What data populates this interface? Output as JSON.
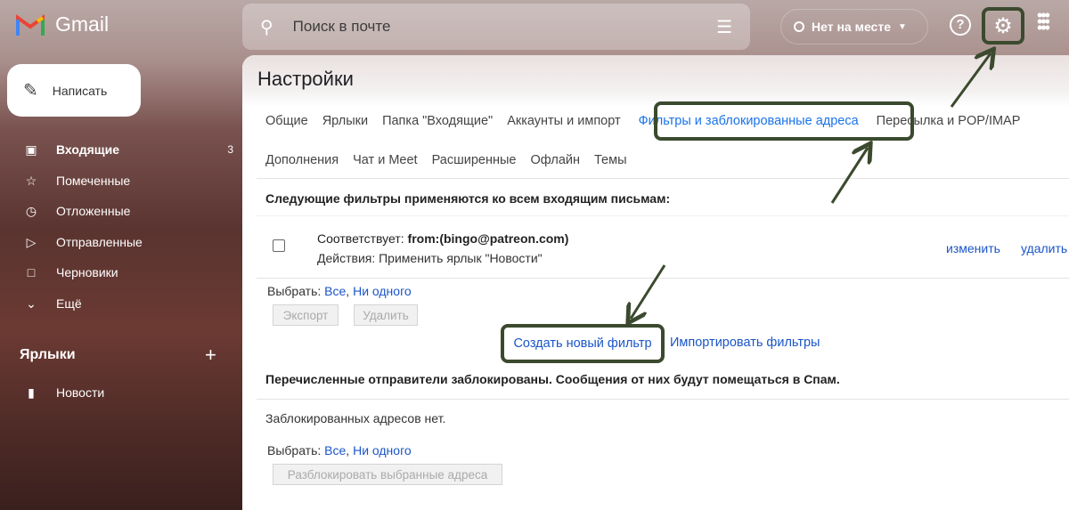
{
  "app": {
    "name": "Gmail"
  },
  "search": {
    "placeholder": "Поиск в почте"
  },
  "status": {
    "label": "Нет на месте"
  },
  "compose": {
    "label": "Написать"
  },
  "nav": [
    {
      "label": "Входящие",
      "count": "3",
      "icon": "inbox-icon"
    },
    {
      "label": "Помеченные",
      "icon": "star-icon"
    },
    {
      "label": "Отложенные",
      "icon": "clock-icon"
    },
    {
      "label": "Отправленные",
      "icon": "send-icon"
    },
    {
      "label": "Черновики",
      "icon": "draft-icon"
    },
    {
      "label": "Ещё",
      "icon": "chevron-down-icon"
    }
  ],
  "labels": {
    "title": "Ярлыки",
    "items": [
      {
        "label": "Новости"
      }
    ]
  },
  "settings": {
    "title": "Настройки",
    "tabs_row1": [
      "Общие",
      "Ярлыки",
      "Папка \"Входящие\"",
      "Аккаунты и импорт",
      "Фильтры и заблокированные адреса",
      "Пересылка и POP/IMAP"
    ],
    "tabs_row2": [
      "Дополнения",
      "Чат и Meet",
      "Расширенные",
      "Офлайн",
      "Темы"
    ],
    "active_tab": "Фильтры и заблокированные адреса",
    "filters_heading": "Следующие фильтры применяются ко всем входящим письмам:",
    "filter": {
      "match_label": "Соответствует:",
      "match_value": "from:(bingo@patreon.com)",
      "action": "Действия: Применить ярлык \"Новости\"",
      "edit": "изменить",
      "delete": "удалить"
    },
    "select_label": "Выбрать:",
    "select_all": "Все",
    "select_none": "Ни одного",
    "export": "Экспорт",
    "remove": "Удалить",
    "create_filter": "Создать новый фильтр",
    "import_filters": "Импортировать фильтры",
    "blocked_heading": "Перечисленные отправители заблокированы. Сообщения от них будут помещаться в Спам.",
    "blocked_empty": "Заблокированных адресов нет.",
    "unblock": "Разблокировать выбранные адреса"
  },
  "annotation_color": "#3b4a2e"
}
